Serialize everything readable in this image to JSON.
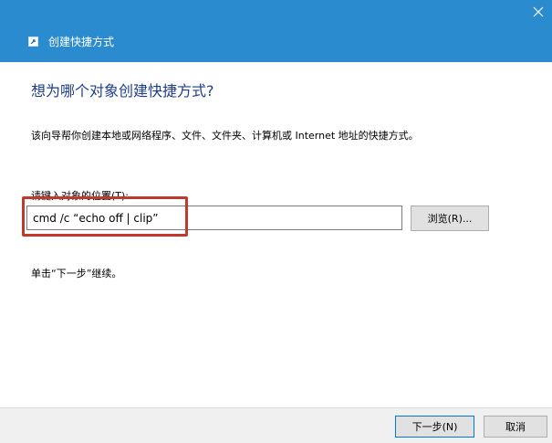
{
  "window": {
    "title": "创建快捷方式",
    "close_icon": "close-icon",
    "app_icon": "shortcut-icon",
    "titlebar_color": "#2b8bcf"
  },
  "page": {
    "heading": "想为哪个对象创建快捷方式?",
    "description": "该向导帮你创建本地或网络程序、文件、文件夹、计算机或 Internet 地址的快捷方式。",
    "location_label": "请键入对象的位置(T):",
    "location_value": "cmd /c “echo off | clip”",
    "browse_label": "浏览(R)...",
    "continue_hint": "单击“下一步”继续。",
    "highlight_color": "#c0392b"
  },
  "footer": {
    "next_label": "下一步(N)",
    "cancel_label": "取消"
  }
}
